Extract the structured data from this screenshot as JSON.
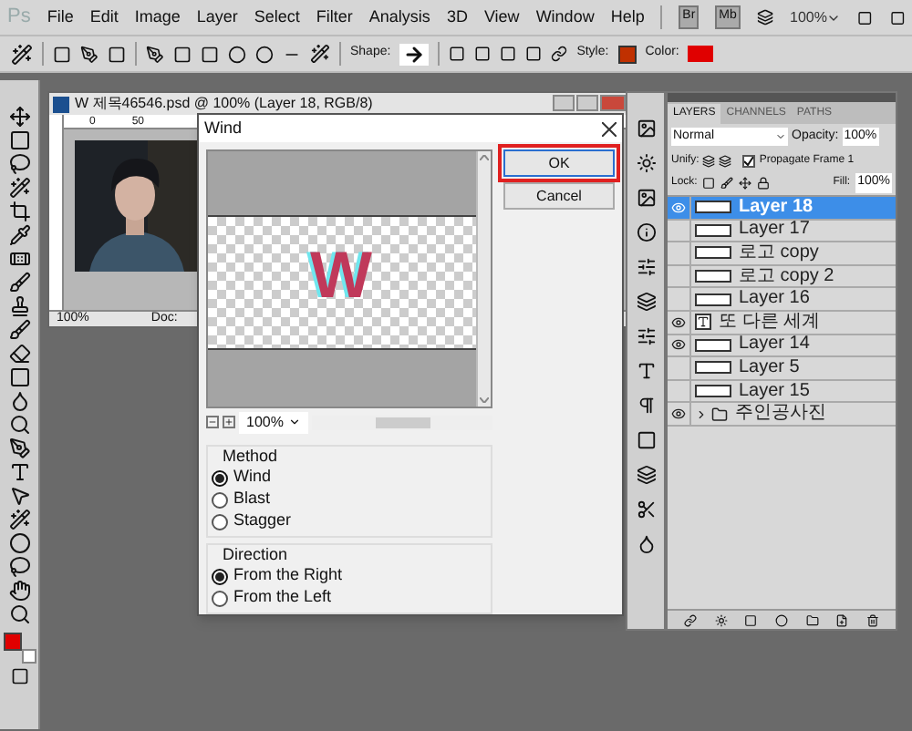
{
  "app_logo": "Ps",
  "menu": [
    "File",
    "Edit",
    "Image",
    "Layer",
    "Select",
    "Filter",
    "Analysis",
    "3D",
    "View",
    "Window",
    "Help"
  ],
  "app_bar": {
    "bridge": "Br",
    "mini_bridge": "Mb",
    "zoom": "100%"
  },
  "options_bar": {
    "shape_label": "Shape:",
    "style_label": "Style:",
    "color_label": "Color:"
  },
  "document": {
    "title": "W 제목46546.psd @ 100% (Layer 18, RGB/8)",
    "ruler_marks": [
      "0",
      "50"
    ],
    "zoom": "100%",
    "status": "Doc:"
  },
  "dialog": {
    "title": "Wind",
    "buttons": [
      {
        "label": "OK",
        "selected": true
      },
      {
        "label": "Cancel",
        "selected": false
      }
    ],
    "preview": {
      "text": "W",
      "zoom": "100%"
    },
    "groups": [
      {
        "title": "Method",
        "options": [
          {
            "label": "Wind",
            "selected": true
          },
          {
            "label": "Blast",
            "selected": false
          },
          {
            "label": "Stagger",
            "selected": false
          }
        ]
      },
      {
        "title": "Direction",
        "options": [
          {
            "label": "From the Right",
            "selected": true
          },
          {
            "label": "From the Left",
            "selected": false
          }
        ]
      }
    ]
  },
  "layers_panel": {
    "tabs": [
      {
        "label": "LAYERS",
        "selected": true
      },
      {
        "label": "CHANNELS",
        "selected": false
      },
      {
        "label": "PATHS",
        "selected": false
      }
    ],
    "blend_mode": "Normal",
    "opacity_label": "Opacity:",
    "opacity": "100%",
    "unify_label": "Unify:",
    "propagate": {
      "label": "Propagate Frame 1",
      "checked": true
    },
    "lock_label": "Lock:",
    "fill_label": "Fill:",
    "fill": "100%",
    "layers": [
      {
        "name": "Layer 18",
        "kind": "pixel",
        "visible": true,
        "selected": true
      },
      {
        "name": "Layer 17",
        "kind": "pixel",
        "visible": false,
        "selected": false
      },
      {
        "name": "로고 copy",
        "kind": "pixel",
        "visible": false,
        "selected": false
      },
      {
        "name": "로고 copy 2",
        "kind": "pixel",
        "visible": false,
        "selected": false
      },
      {
        "name": "Layer 16",
        "kind": "pixel",
        "visible": false,
        "selected": false
      },
      {
        "name": "또 다른 세계",
        "kind": "text",
        "visible": true,
        "selected": false
      },
      {
        "name": "Layer 14",
        "kind": "pixel",
        "visible": true,
        "selected": false
      },
      {
        "name": "Layer 5",
        "kind": "pixel",
        "visible": false,
        "selected": false
      },
      {
        "name": "Layer 15",
        "kind": "pixel",
        "visible": false,
        "selected": false
      },
      {
        "name": "주인공사진",
        "kind": "group",
        "visible": true,
        "selected": false
      }
    ]
  }
}
